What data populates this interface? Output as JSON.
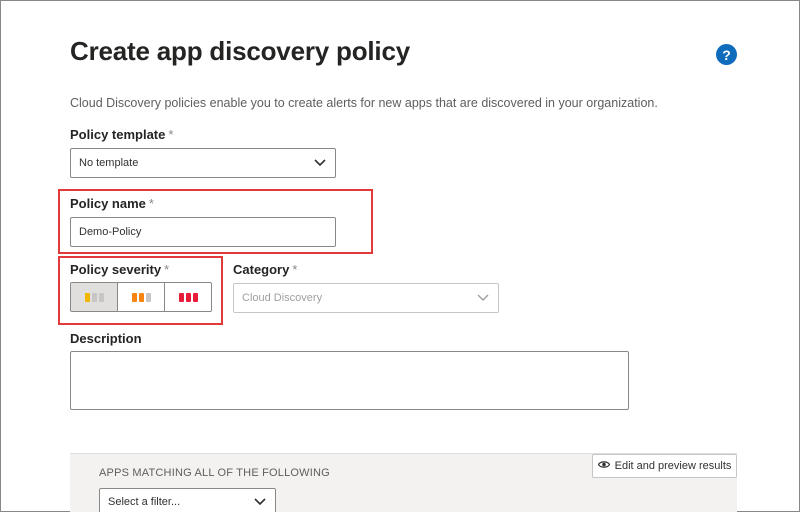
{
  "page": {
    "title": "Create app discovery policy",
    "subtitle": "Cloud Discovery policies enable you to create alerts for new apps that are discovered in your organization.",
    "help_glyph": "?"
  },
  "policy_template": {
    "label": "Policy template",
    "required_mark": "*",
    "value": "No template"
  },
  "policy_name": {
    "label": "Policy name",
    "required_mark": "*",
    "value": "Demo-Policy"
  },
  "policy_severity": {
    "label": "Policy severity",
    "required_mark": "*",
    "options": [
      {
        "name": "low",
        "colors": [
          "#f2b600",
          "#c8c6c4",
          "#c8c6c4"
        ]
      },
      {
        "name": "medium",
        "colors": [
          "#f7850f",
          "#f7850f",
          "#c8c6c4"
        ]
      },
      {
        "name": "high",
        "colors": [
          "#e81d3a",
          "#e81d3a",
          "#e81d3a"
        ]
      }
    ],
    "selected": "low"
  },
  "category": {
    "label": "Category",
    "required_mark": "*",
    "value": "Cloud Discovery"
  },
  "description": {
    "label": "Description",
    "value": ""
  },
  "filters": {
    "heading": "APPS MATCHING ALL OF THE FOLLOWING",
    "select_placeholder": "Select a filter...",
    "preview_button": "Edit and preview results"
  },
  "colors": {
    "accent": "#0f6cbd",
    "highlight": "#e23a3a"
  }
}
